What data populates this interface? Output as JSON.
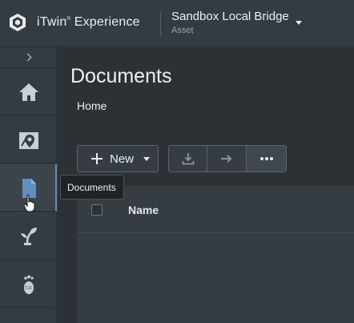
{
  "header": {
    "brand": "iTwin",
    "brand_mark": "®",
    "brand_suffix": " Experience",
    "context_title": "Sandbox Local Bridge",
    "context_subtitle": "Asset"
  },
  "sidebar": {
    "items": [
      {
        "name": "home",
        "icon": "home-icon"
      },
      {
        "name": "map",
        "icon": "map-pin-icon"
      },
      {
        "name": "documents",
        "icon": "document-icon",
        "active": true
      },
      {
        "name": "plant",
        "icon": "sprout-icon"
      },
      {
        "name": "carbon",
        "icon": "footprint-icon"
      }
    ]
  },
  "main": {
    "title": "Documents",
    "breadcrumb": "Home",
    "toolbar": {
      "new_label": "New"
    },
    "table": {
      "columns": [
        "Name"
      ]
    }
  },
  "tooltip": "Documents",
  "colors": {
    "accent": "#5f8ebf",
    "header_bg": "#333c41",
    "main_bg": "#2b3134"
  }
}
